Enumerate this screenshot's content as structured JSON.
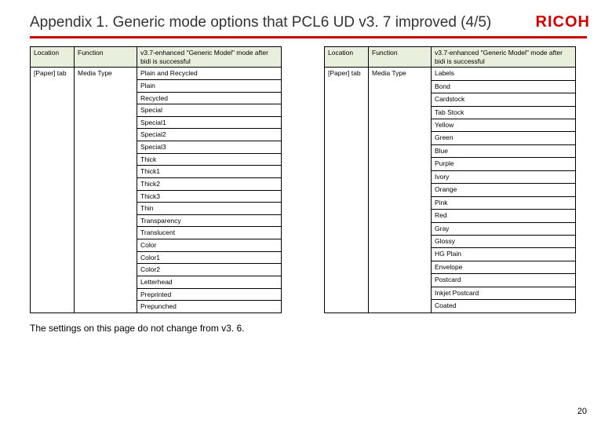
{
  "title": "Appendix 1. Generic mode options that PCL6 UD v3. 7 improved (4/5)",
  "logo": "RICOH",
  "page_number": "20",
  "footnote": "The settings on this page do not change from v3. 6.",
  "table_headers": {
    "location": "Location",
    "function": "Function",
    "mode": "v3.7-enhanced \"Generic Model\" mode after bidi is successful"
  },
  "tables": [
    {
      "location": "[Paper] tab",
      "function": "Media Type",
      "values": [
        "Plain and Recycled",
        "Plain",
        "Recycled",
        "Special",
        "Special1",
        "Special2",
        "Special3",
        "Thick",
        "Thick1",
        "Thick2",
        "Thick3",
        "Thin",
        "Transparency",
        "Translucent",
        "Color",
        "Color1",
        "Color2",
        "Letterhead",
        "Preprinted",
        "Prepunched"
      ]
    },
    {
      "location": "[Paper] tab",
      "function": "Media Type",
      "values": [
        "Labels",
        "Bond",
        "Cardstock",
        "Tab Stock",
        "Yellow",
        "Green",
        "Blue",
        "Purple",
        "Ivory",
        "Orange",
        "Pink",
        "Red",
        "Gray",
        "Glossy",
        "HG Plain",
        "Envelope",
        "Postcard",
        "Inkjet Postcard",
        "Coated"
      ]
    }
  ]
}
